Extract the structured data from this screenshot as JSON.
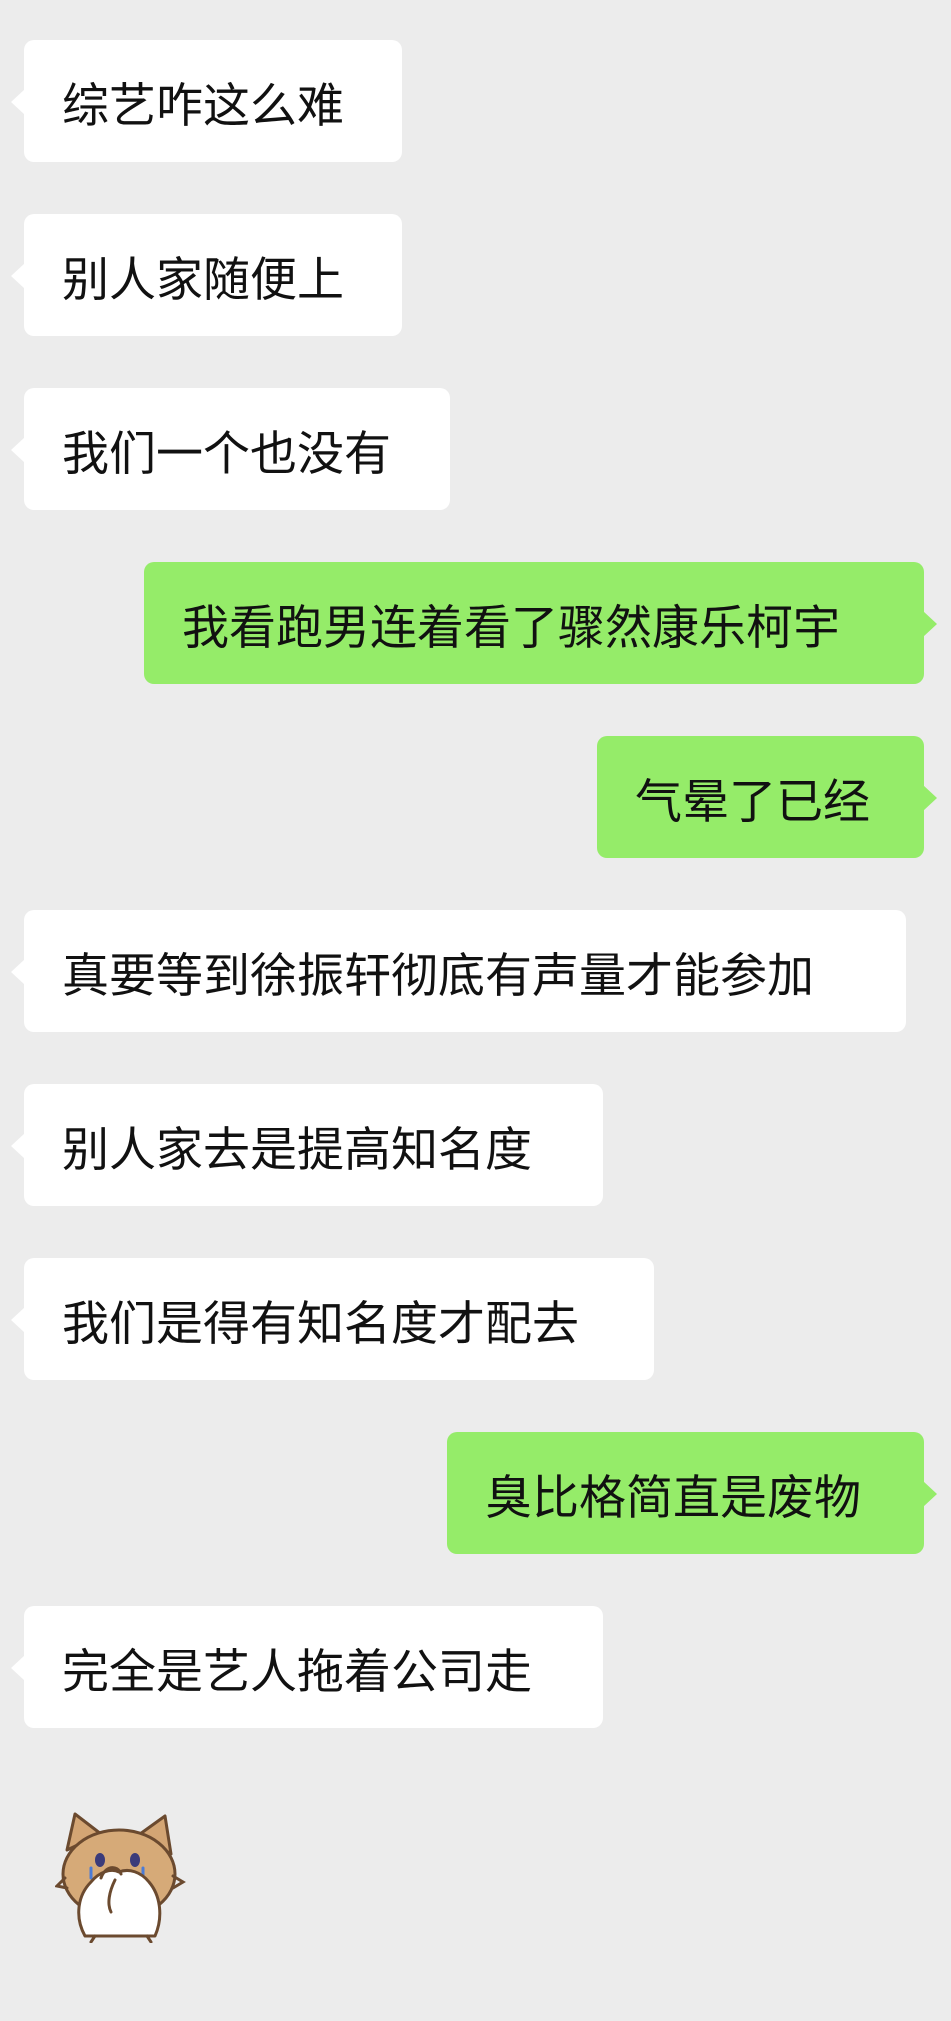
{
  "messages": [
    {
      "side": "in",
      "text": "综艺咋这么难"
    },
    {
      "side": "in",
      "text": "别人家随便上"
    },
    {
      "side": "in",
      "text": "我们一个也没有"
    },
    {
      "side": "out",
      "text": "我看跑男连着看了骤然康乐柯宇"
    },
    {
      "side": "out",
      "text": "气晕了已经"
    },
    {
      "side": "in",
      "text": "真要等到徐振轩彻底有声量才能参加"
    },
    {
      "side": "in",
      "text": "别人家去是提高知名度"
    },
    {
      "side": "in",
      "text": "我们是得有知名度才配去"
    },
    {
      "side": "out",
      "text": "臭比格简直是废物"
    },
    {
      "side": "in",
      "text": "完全是艺人拖着公司走"
    }
  ],
  "sticker": {
    "icon": "cat-covering-face-sticker"
  },
  "colors": {
    "background": "#ececec",
    "incoming_bubble": "#ffffff",
    "outgoing_bubble": "#95ec69",
    "text": "#111111"
  }
}
